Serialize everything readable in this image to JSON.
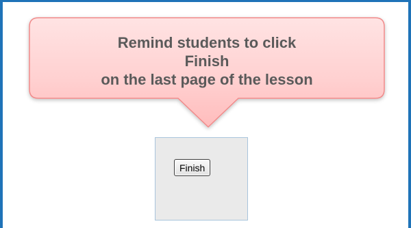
{
  "callout": {
    "line1": "Remind students to click",
    "line2": "Finish",
    "line3": "on the last page of the lesson",
    "fill_color": "#ffc8c8",
    "border_color": "#f08a8a"
  },
  "panel": {
    "finish_label": "Finish"
  },
  "frame": {
    "border_color": "#1f73b8"
  }
}
